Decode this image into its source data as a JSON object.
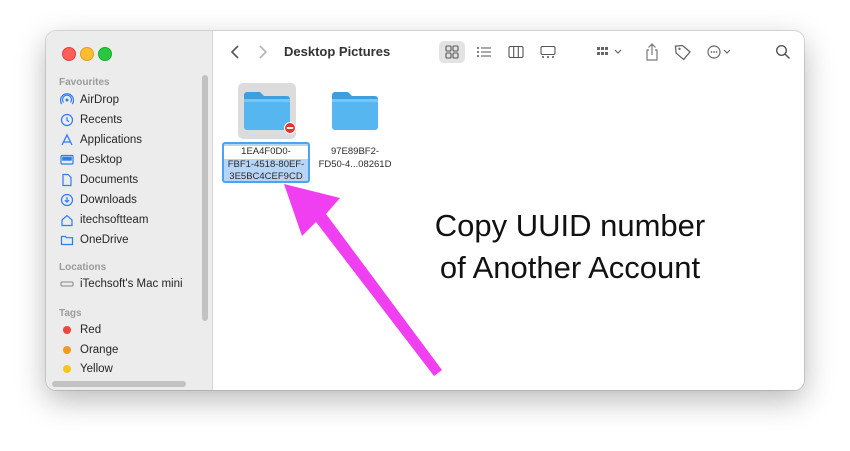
{
  "window": {
    "title": "Desktop Pictures"
  },
  "sidebar": {
    "favourites_title": "Favourites",
    "favourites": [
      {
        "label": "AirDrop",
        "icon": "airdrop-icon"
      },
      {
        "label": "Recents",
        "icon": "clock-icon"
      },
      {
        "label": "Applications",
        "icon": "applications-icon"
      },
      {
        "label": "Desktop",
        "icon": "desktop-icon"
      },
      {
        "label": "Documents",
        "icon": "document-icon"
      },
      {
        "label": "Downloads",
        "icon": "download-icon"
      },
      {
        "label": "itechsoftteam",
        "icon": "home-icon"
      },
      {
        "label": "OneDrive",
        "icon": "folder-icon"
      }
    ],
    "locations_title": "Locations",
    "locations": [
      {
        "label": "iTechsoft's Mac mini",
        "icon": "computer-icon"
      }
    ],
    "tags_title": "Tags",
    "tags": [
      {
        "label": "Red",
        "color": "#f0453a"
      },
      {
        "label": "Orange",
        "color": "#f39a1f"
      },
      {
        "label": "Yellow",
        "color": "#f5c518"
      }
    ]
  },
  "toolbar": {
    "icons": [
      "back-icon",
      "forward-icon",
      "icon-view-icon",
      "list-view-icon",
      "column-view-icon",
      "gallery-view-icon",
      "group-icon",
      "share-icon",
      "tag-icon",
      "more-icon",
      "search-icon"
    ]
  },
  "files": [
    {
      "name_lines": [
        "1EA4F0D0-",
        "FBF1-4518-80EF-",
        "3E5BC4CEF9CD"
      ],
      "selected": true,
      "badge": "no-entry-icon"
    },
    {
      "name_lines": [
        "97E89BF2-",
        "FD50-4...08261D"
      ],
      "selected": false
    }
  ],
  "annotation": {
    "line1": "Copy UUID number",
    "line2": "of Another Account"
  },
  "colors": {
    "folder": "#4fb2ee",
    "folder_tab": "#3d9fde",
    "arrow": "#f03ff0",
    "selection": "#b7d6f7"
  }
}
